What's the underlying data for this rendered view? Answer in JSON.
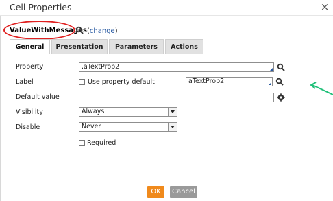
{
  "dialog": {
    "title": "Cell Properties",
    "close_glyph": "×",
    "close_icon": "close-icon"
  },
  "rule": {
    "name": "ValueWithMessages",
    "change_open": "(",
    "change_label": "change",
    "change_close": ")",
    "search_icon": "search-icon"
  },
  "tabs": [
    {
      "label": "General",
      "active": true
    },
    {
      "label": "Presentation",
      "active": false
    },
    {
      "label": "Parameters",
      "active": false
    },
    {
      "label": "Actions",
      "active": false
    }
  ],
  "form": {
    "property": {
      "label": "Property",
      "value": ".aTextProp2",
      "icon": "search-icon"
    },
    "label": {
      "label": "Label",
      "checkbox_label": "Use property default",
      "checked": false,
      "value": "aTextProp2",
      "icon": "search-icon"
    },
    "default_value": {
      "label": "Default value",
      "value": "",
      "icon": "gear-icon"
    },
    "visibility": {
      "label": "Visibility",
      "selected": "Always"
    },
    "disable": {
      "label": "Disable",
      "selected": "Never"
    },
    "required": {
      "label": "Required",
      "checked": false
    }
  },
  "footer": {
    "ok_label": "OK",
    "cancel_label": "Cancel"
  },
  "colors": {
    "ok_button": "#f08a1c",
    "cancel_button": "#9a9a9a",
    "highlight_ellipse": "#e02020",
    "annotation_arrow": "#22c07a",
    "link": "#1a4f9c"
  }
}
